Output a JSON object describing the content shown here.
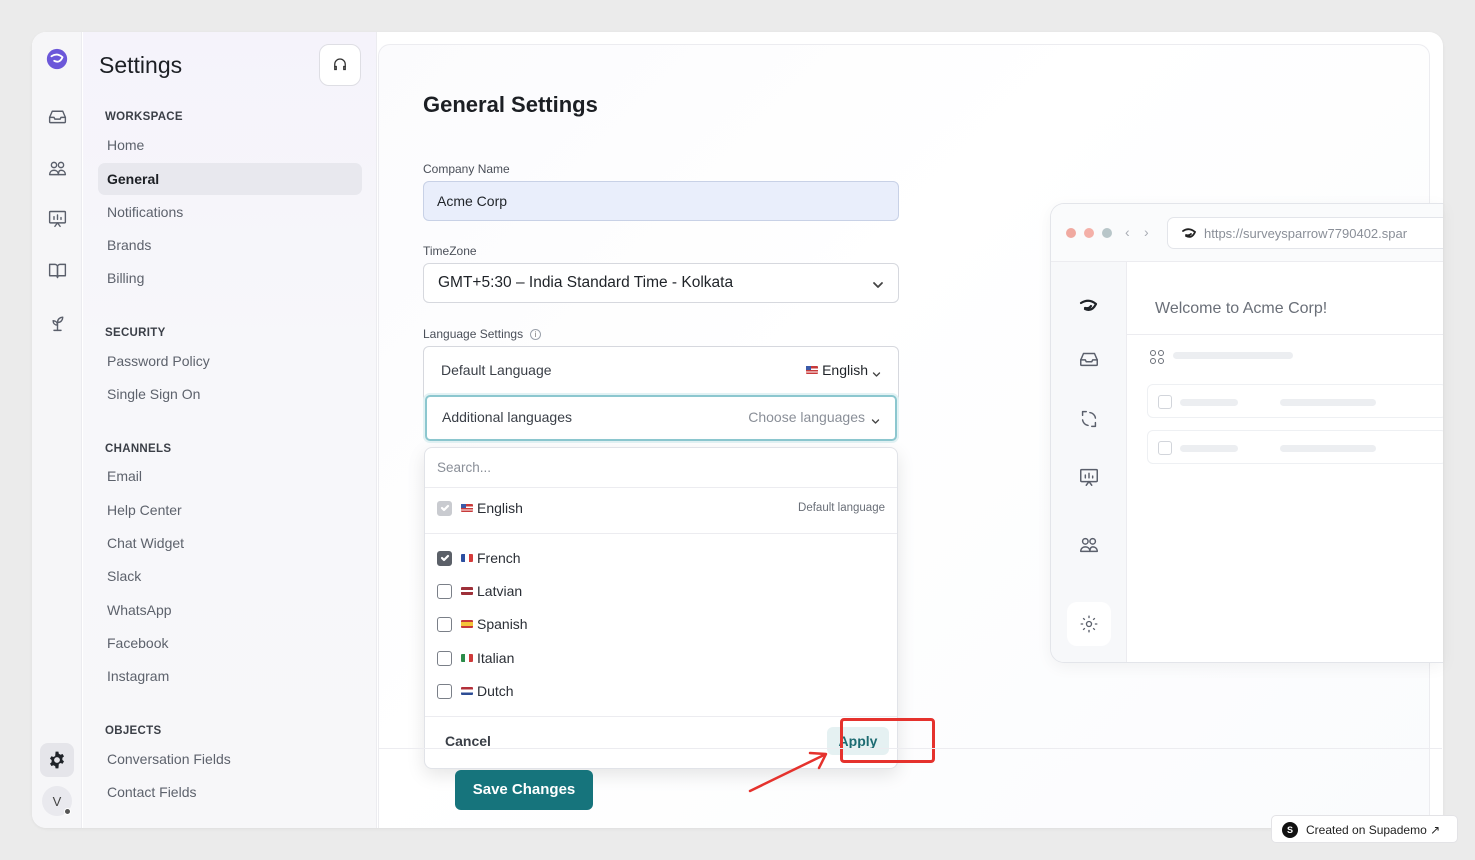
{
  "sidebar": {
    "title": "Settings",
    "sections": [
      {
        "label": "WORKSPACE",
        "items": [
          "Home",
          "General",
          "Notifications",
          "Brands",
          "Billing"
        ]
      },
      {
        "label": "SECURITY",
        "items": [
          "Password Policy",
          "Single Sign On"
        ]
      },
      {
        "label": "CHANNELS",
        "items": [
          "Email",
          "Help Center",
          "Chat Widget",
          "Slack",
          "WhatsApp",
          "Facebook",
          "Instagram"
        ]
      },
      {
        "label": "OBJECTS",
        "items": [
          "Conversation Fields",
          "Contact Fields"
        ]
      }
    ],
    "active_item": "General",
    "avatar_initial": "V"
  },
  "main": {
    "title": "General Settings",
    "company_name_label": "Company Name",
    "company_name_value": "Acme Corp",
    "timezone_label": "TimeZone",
    "timezone_value": "GMT+5:30 – India Standard Time - Kolkata",
    "language_settings_label": "Language Settings",
    "info_glyph": "i",
    "default_language_label": "Default Language",
    "default_language_value": "English",
    "additional_languages_label": "Additional languages",
    "additional_languages_placeholder": "Choose languages",
    "save_button": "Save Changes"
  },
  "dropdown": {
    "search_placeholder": "Search...",
    "default_option": {
      "label": "English",
      "tag": "Default language",
      "checked": true
    },
    "options": [
      {
        "label": "French",
        "checked": true
      },
      {
        "label": "Latvian",
        "checked": false
      },
      {
        "label": "Spanish",
        "checked": false
      },
      {
        "label": "Italian",
        "checked": false
      },
      {
        "label": "Dutch",
        "checked": false
      }
    ],
    "cancel": "Cancel",
    "apply": "Apply"
  },
  "preview": {
    "url": "https://surveysparrow7790402.spar",
    "welcome": "Welcome to Acme Corp!"
  },
  "badge": {
    "text": "Created on Supademo",
    "logo": "S",
    "arrow": "↗"
  },
  "colors": {
    "primary": "#16747c",
    "focus_ring": "#8cc7cf",
    "highlight": "#e5322d",
    "apply_bg": "#e5f1f2"
  },
  "icons": {
    "rail": [
      "logo-icon",
      "inbox-icon",
      "users-icon",
      "reports-icon",
      "knowledge-base-icon",
      "plant-icon",
      "gear-icon"
    ],
    "preview_rail": [
      "logo-icon",
      "inbox-icon",
      "conversation-icon",
      "reports-icon",
      "users-icon",
      "gear-icon"
    ]
  }
}
